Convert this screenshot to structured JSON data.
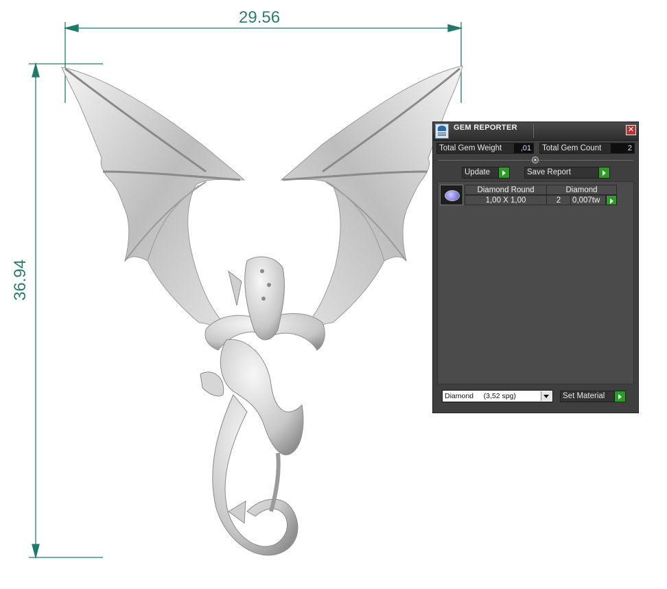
{
  "dimensions": {
    "width_value": "29.56",
    "height_value": "36.94",
    "line_color": "#1f7a6a"
  },
  "gem_reporter": {
    "title": "GEM REPORTER",
    "close_glyph": "✕",
    "total_weight_label": "Total Gem Weight",
    "total_weight_value": ",01",
    "total_count_label": "Total Gem Count",
    "total_count_value": "2",
    "update_label": "Update",
    "save_report_label": "Save Report",
    "table": {
      "headers": [
        "Diamond Round",
        "Diamond"
      ],
      "rows": [
        {
          "size": "1,00 X 1,00",
          "count": "2",
          "weight": "0,007tw"
        }
      ]
    },
    "material_select": "Diamond     (3,52 spg)",
    "set_material_label": "Set Material"
  },
  "icons": {
    "panel_icon": "gem-reporter-icon",
    "gem_icon": "round-diamond-icon"
  }
}
